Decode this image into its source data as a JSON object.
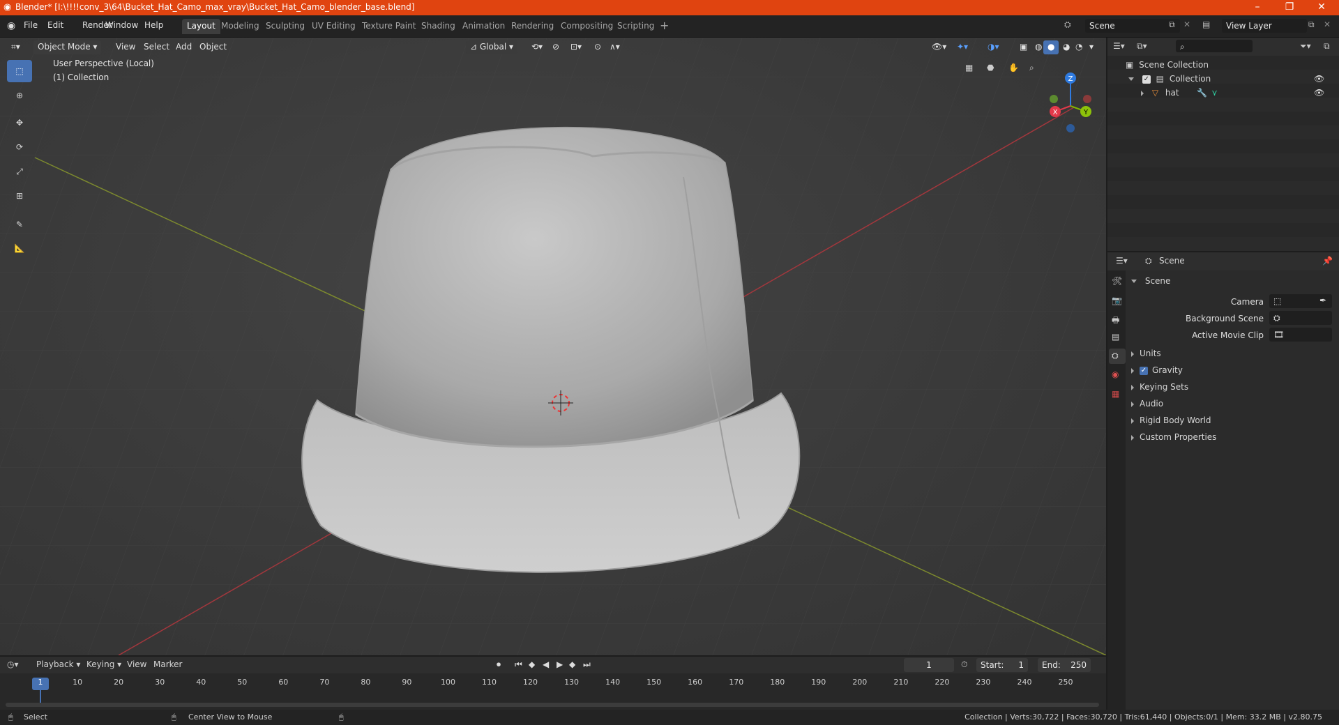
{
  "window": {
    "title": "Blender* [I:\\!!!!conv_3\\64\\Bucket_Hat_Camo_max_vray\\Bucket_Hat_Camo_blender_base.blend]",
    "accent": "#e04410"
  },
  "menu": {
    "items": [
      "File",
      "Edit",
      "Render",
      "Window",
      "Help"
    ]
  },
  "workspaces": [
    "Layout",
    "Modeling",
    "Sculpting",
    "UV Editing",
    "Texture Paint",
    "Shading",
    "Animation",
    "Rendering",
    "Compositing",
    "Scripting"
  ],
  "active_workspace": "Layout",
  "scene_selector": {
    "value": "Scene"
  },
  "view_layer_selector": {
    "value": "View Layer"
  },
  "viewport": {
    "mode": "Object Mode",
    "menus": [
      "View",
      "Select",
      "Add",
      "Object"
    ],
    "orientation": "Global",
    "info_line1": "User Perspective (Local)",
    "info_line2": "(1) Collection",
    "gizmo_axes": {
      "z": "Z",
      "x": "X",
      "y": "Y"
    }
  },
  "outliner": {
    "root": "Scene Collection",
    "items": [
      {
        "label": "Collection"
      },
      {
        "label": "hat"
      }
    ]
  },
  "properties": {
    "header_title": "Scene",
    "section_title": "Scene",
    "fields": [
      {
        "label": "Camera",
        "value": ""
      },
      {
        "label": "Background Scene",
        "value": ""
      },
      {
        "label": "Active Movie Clip",
        "value": ""
      }
    ],
    "panels": [
      "Units",
      "Gravity",
      "Keying Sets",
      "Audio",
      "Rigid Body World",
      "Custom Properties"
    ],
    "gravity_checked": true
  },
  "timeline": {
    "menus": [
      "Playback",
      "Keying",
      "View",
      "Marker"
    ],
    "current_frame": "1",
    "start_label": "Start:",
    "start_value": "1",
    "end_label": "End:",
    "end_value": "250",
    "ticks": [
      "1",
      "10",
      "20",
      "30",
      "40",
      "50",
      "60",
      "70",
      "80",
      "90",
      "100",
      "110",
      "120",
      "130",
      "140",
      "150",
      "160",
      "170",
      "180",
      "190",
      "200",
      "210",
      "220",
      "230",
      "240",
      "250"
    ]
  },
  "statusbar": {
    "left_action": "Select",
    "middle_action": "Center View to Mouse",
    "stats": "Collection | Verts:30,722 | Faces:30,720 | Tris:61,440 | Objects:0/1 | Mem: 33.2 MB | v2.80.75"
  }
}
